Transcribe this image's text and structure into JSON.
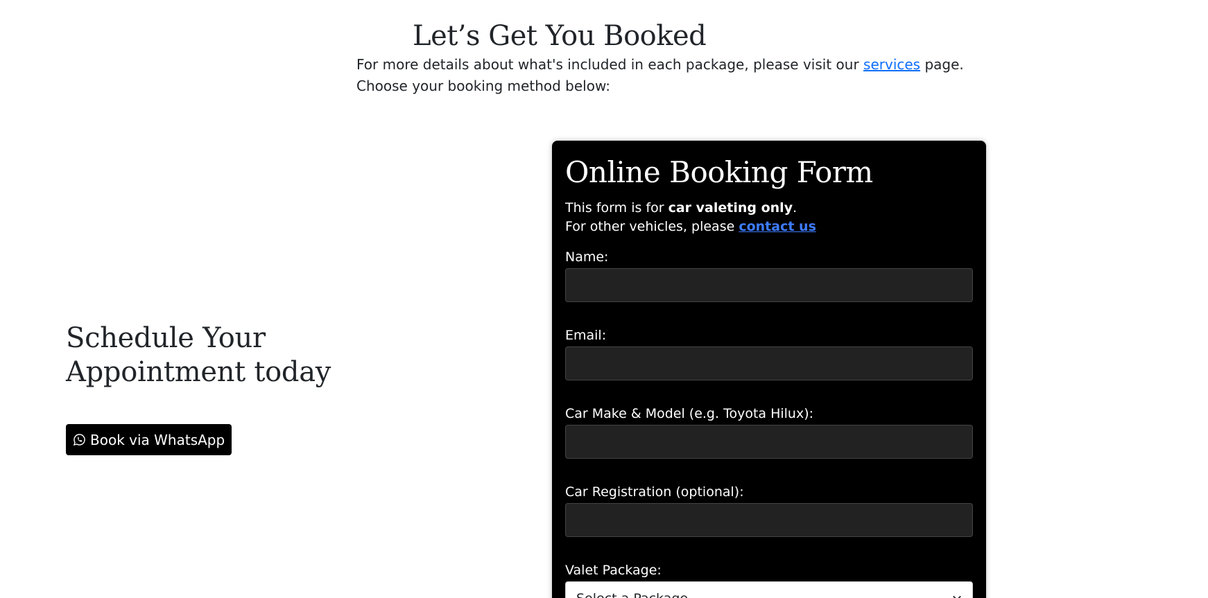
{
  "intro": {
    "title": "Let’s Get You Booked",
    "line1_prefix": "For more details about what's included in each package, please visit our ",
    "services_link": "services",
    "line1_suffix": " page.",
    "line2": "Choose your booking method below:"
  },
  "schedule": {
    "heading_line1": "Schedule Your",
    "heading_line2": "Appointment today",
    "whatsapp_icon": "whatsapp-icon",
    "whatsapp_button": "Book via WhatsApp"
  },
  "form": {
    "title": "Online Booking Form",
    "note_prefix": "This form is for ",
    "note_bold": "car valeting only",
    "note_suffix": ".",
    "note2_prefix": "For other vehicles, please ",
    "contact_link": "contact us",
    "fields": {
      "name_label": "Name:",
      "name_value": "",
      "email_label": "Email:",
      "email_value": "",
      "car_label": "Car Make & Model (e.g. Toyota Hilux):",
      "car_value": "",
      "reg_label": "Car Registration (optional):",
      "reg_value": "",
      "package_label": "Valet Package:",
      "package_selected": "Select a Package"
    }
  },
  "colors": {
    "form_background": "#000000",
    "input_background": "#222222",
    "link_blue": "#0d6efd",
    "contact_link": "#3d7bff"
  }
}
